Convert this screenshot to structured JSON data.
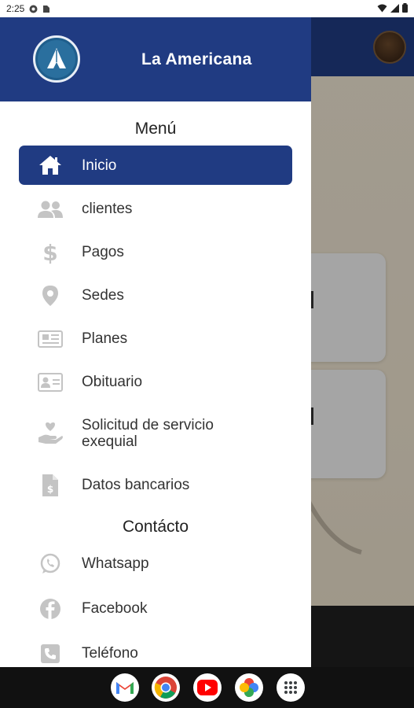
{
  "status_bar": {
    "time": "2:25"
  },
  "drawer": {
    "app_title": "La Americana",
    "menu_section_title": "Menú",
    "items": [
      {
        "label": "Inicio",
        "icon": "home-icon",
        "active": true
      },
      {
        "label": "clientes",
        "icon": "users-icon"
      },
      {
        "label": "Pagos",
        "icon": "dollar-icon"
      },
      {
        "label": "Sedes",
        "icon": "location-pin-icon"
      },
      {
        "label": "Planes",
        "icon": "newspaper-icon"
      },
      {
        "label": "Obituario",
        "icon": "id-card-icon"
      },
      {
        "label": "Solicitud de servicio exequial",
        "icon": "hand-heart-icon"
      },
      {
        "label": "Datos bancarios",
        "icon": "invoice-icon"
      }
    ],
    "contact_section_title": "Contácto",
    "contact_items": [
      {
        "label": "Whatsapp",
        "icon": "whatsapp-icon"
      },
      {
        "label": "Facebook",
        "icon": "facebook-icon"
      },
      {
        "label": "Teléfono",
        "icon": "phone-icon"
      }
    ]
  },
  "colors": {
    "primary": "#203b82",
    "icon_gray": "#c4c4c4"
  },
  "dock": {
    "apps": [
      "gmail-icon",
      "chrome-icon",
      "youtube-icon",
      "photos-icon",
      "app-drawer-icon"
    ]
  }
}
